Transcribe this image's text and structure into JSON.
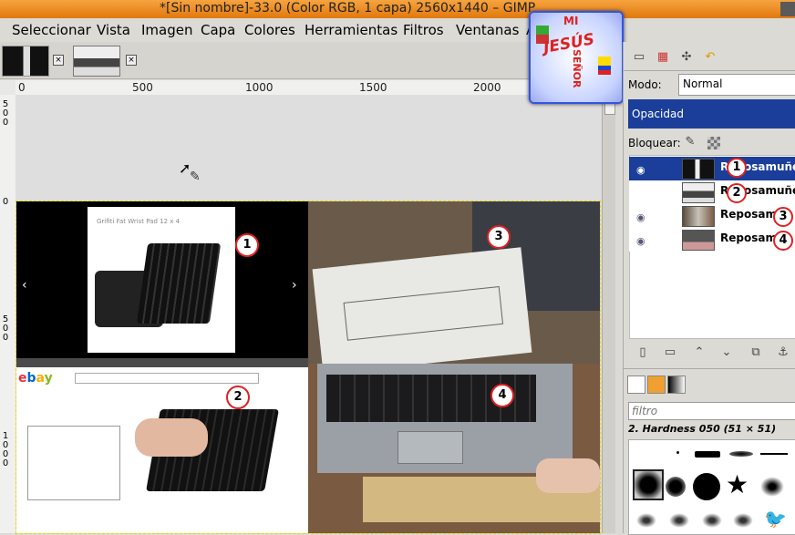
{
  "window": {
    "title": "*[Sin nombre]-33.0 (Color RGB, 1 capa) 2560x1440 – GIMP"
  },
  "menu": {
    "items": [
      "Seleccionar",
      "Vista",
      "Imagen",
      "Capa",
      "Colores",
      "Herramientas",
      "Filtros",
      "Ventanas",
      "A"
    ]
  },
  "ruler": {
    "h_ticks": [
      "0",
      "500",
      "1000",
      "1500",
      "2000"
    ],
    "v_ticks": [
      "500",
      "0",
      "500",
      "1000"
    ]
  },
  "logo": {
    "text_top": "MI",
    "text_main": "JESÚS",
    "text_side": "SEÑOR"
  },
  "layers_panel": {
    "mode_label": "Modo:",
    "mode_value": "Normal",
    "opacity_label": "Opacidad",
    "lock_label": "Bloquear:",
    "layers": [
      {
        "name": "Reposamuñeca",
        "badge": "1"
      },
      {
        "name": "Reposamuñeca",
        "badge": "2"
      },
      {
        "name": "Reposamu",
        "badge": "3"
      },
      {
        "name": "Reposamu",
        "badge": "4"
      }
    ]
  },
  "brushes_panel": {
    "filter_placeholder": "filtro",
    "brush_name": "2. Hardness 050 (51 × 51)"
  },
  "canvas": {
    "badges": [
      "1",
      "2",
      "3",
      "4"
    ],
    "ebay_logo": "ebay",
    "product_title": "Grifiti Fat Wrist Pad 12 x 4"
  },
  "colors": {
    "title_bar": "#e98a22",
    "accent": "#1a3e9a",
    "badge_border": "#dd2222"
  }
}
